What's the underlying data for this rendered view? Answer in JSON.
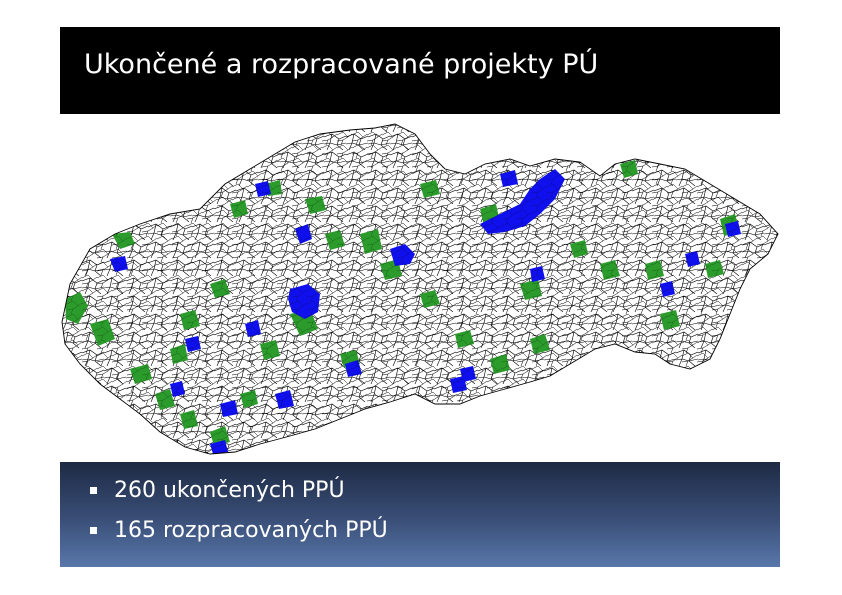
{
  "slide": {
    "title": "Ukončené a rozpracované projekty PÚ"
  },
  "map": {
    "region": "Slovakia municipal boundaries",
    "colors": {
      "completed": "#2b9b2b",
      "in_progress": "#1010ee",
      "outline": "#000000",
      "background": "#ffffff"
    }
  },
  "bullets": [
    {
      "text": "260 ukončených PPÚ"
    },
    {
      "text": "165 rozpracovaných PPÚ"
    }
  ]
}
